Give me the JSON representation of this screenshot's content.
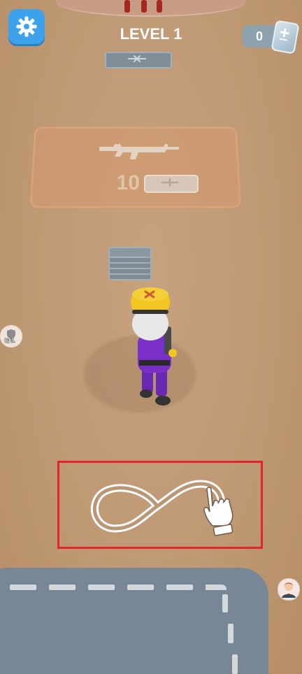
{
  "hud": {
    "level_label": "LEVEL 1",
    "card_count": "0"
  },
  "icons": {
    "settings": "gear-icon",
    "card": "card-icon",
    "weapon": "rifle-icon",
    "privacy": "shield-icon",
    "tutorial": "hand-pointer-icon",
    "avatar": "avatar-icon"
  },
  "shop": {
    "price": "10"
  },
  "privacy": {
    "label": "隐私"
  },
  "colors": {
    "settings_bg": "#3ca2ec",
    "tutorial_border": "#e2262b",
    "ground": "#c29b77",
    "road": "#778795",
    "player_uniform": "#7a2fc9",
    "player_helmet": "#f2c51f"
  }
}
